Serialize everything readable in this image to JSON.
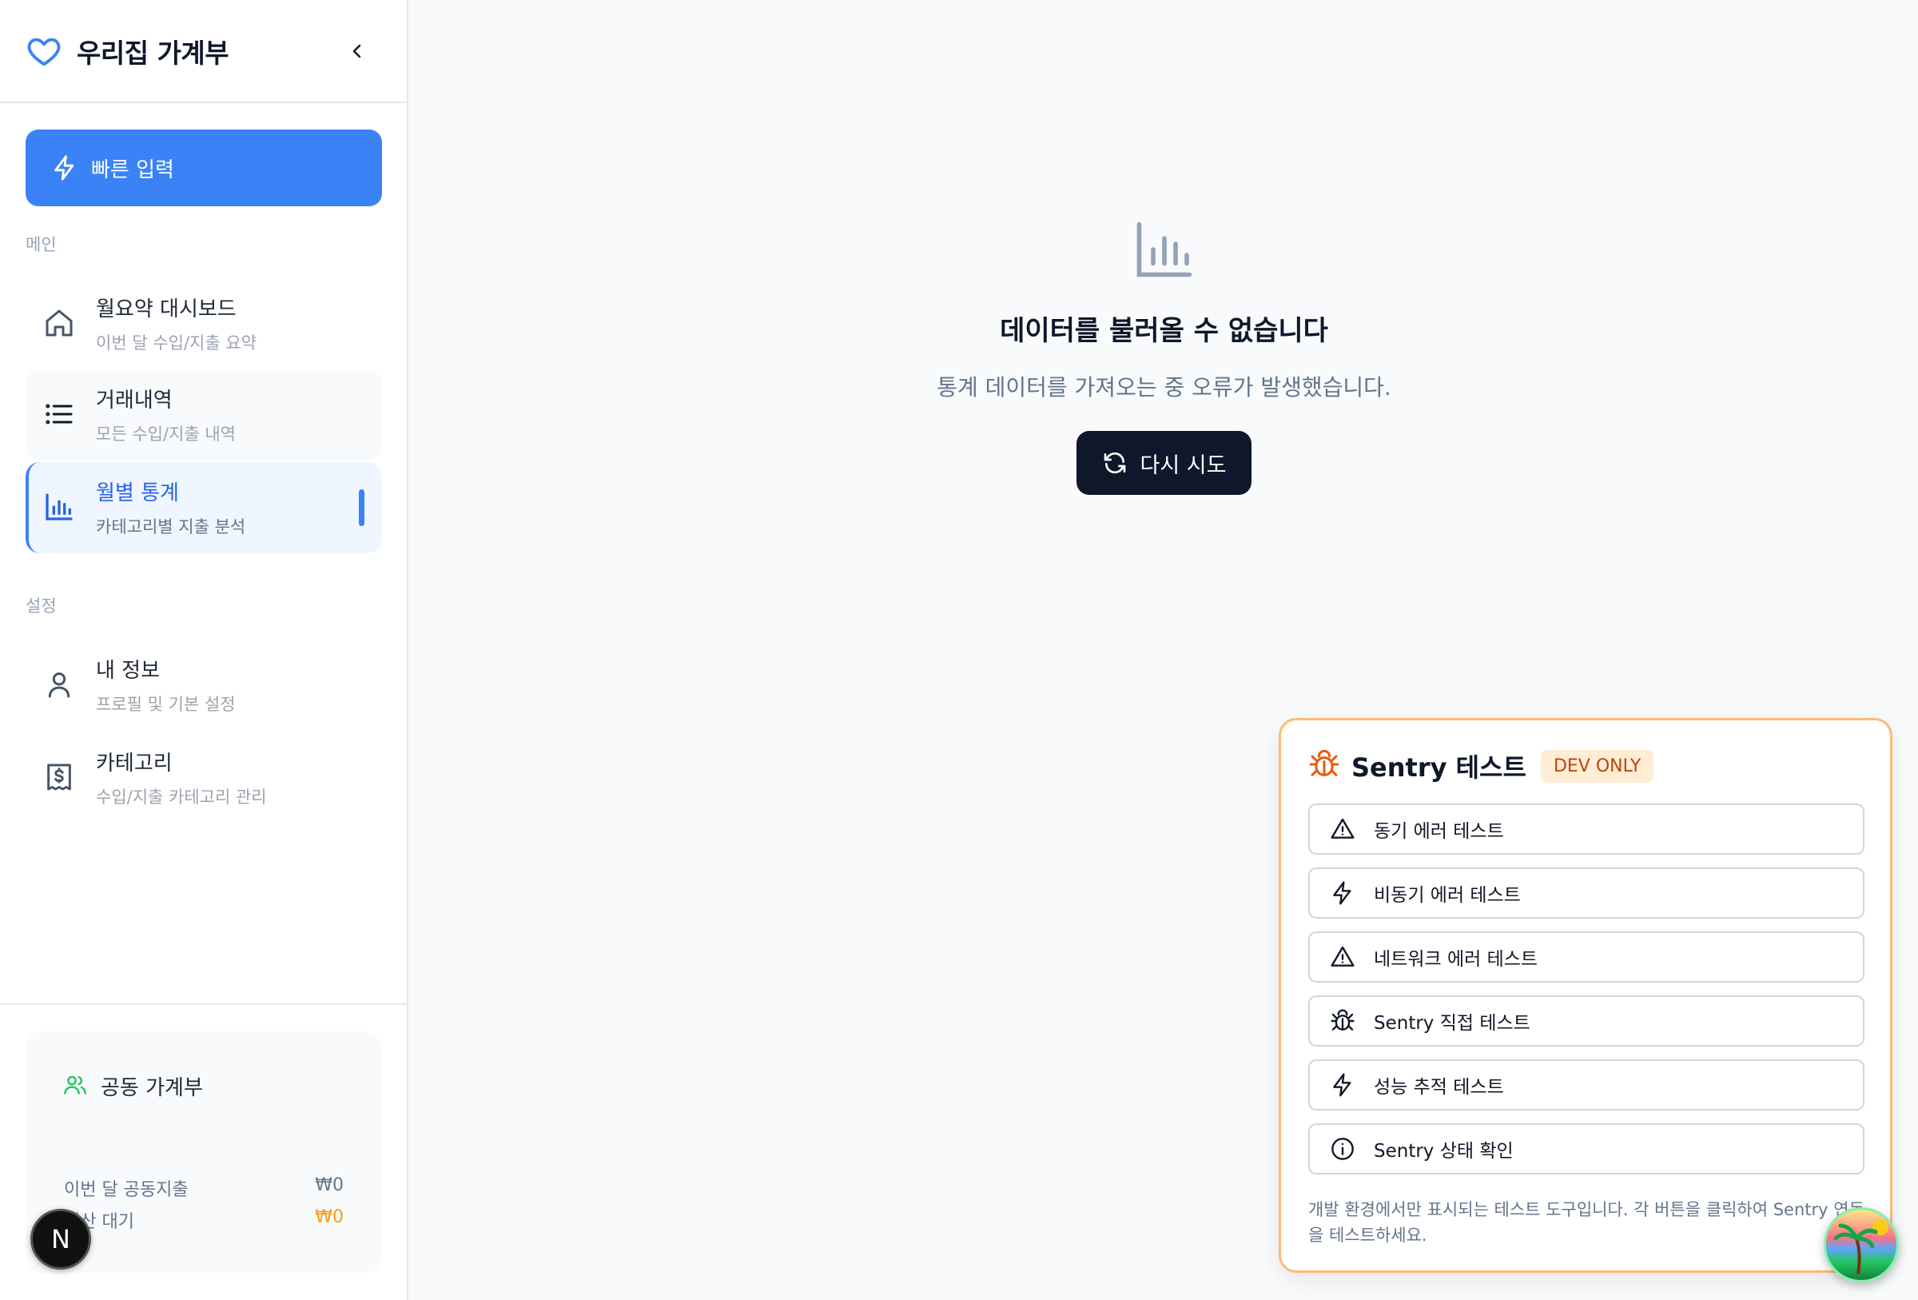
{
  "sidebar": {
    "app_title": "우리집 가계부",
    "quick_input_label": "빠른 입력",
    "sections": {
      "main": "메인",
      "settings": "설정"
    },
    "items": [
      {
        "title": "월요약 대시보드",
        "subtitle": "이번 달 수입/지출 요약",
        "icon": "home-icon"
      },
      {
        "title": "거래내역",
        "subtitle": "모든 수입/지출 내역",
        "icon": "list-icon"
      },
      {
        "title": "월별 통계",
        "subtitle": "카테고리별 지출 분석",
        "icon": "bar-chart-icon",
        "active": true
      },
      {
        "title": "내 정보",
        "subtitle": "프로필 및 기본 설정",
        "icon": "user-icon"
      },
      {
        "title": "카테고리",
        "subtitle": "수입/지출 카테고리 관리",
        "icon": "receipt-icon"
      }
    ],
    "shared_budget": {
      "title": "공동 가계부",
      "rows": [
        {
          "label": "이번 달 공동지출",
          "amount": "₩0"
        },
        {
          "label": "정산 대기",
          "amount": "₩0"
        }
      ]
    }
  },
  "main": {
    "error_title": "데이터를 불러올 수 없습니다",
    "error_description": "통계 데이터를 가져오는 중 오류가 발생했습니다.",
    "retry_label": "다시 시도"
  },
  "sentry_panel": {
    "title": "Sentry 테스트",
    "badge": "DEV ONLY",
    "buttons": [
      {
        "label": "동기 에러 테스트",
        "icon": "warning-icon"
      },
      {
        "label": "비동기 에러 테스트",
        "icon": "lightning-icon"
      },
      {
        "label": "네트워크 에러 테스트",
        "icon": "warning-icon"
      },
      {
        "label": "Sentry 직접 테스트",
        "icon": "bug-icon"
      },
      {
        "label": "성능 추적 테스트",
        "icon": "lightning-icon"
      },
      {
        "label": "Sentry 상태 확인",
        "icon": "info-icon"
      }
    ],
    "note": "개발 환경에서만 표시되는 테스트 도구입니다. 각 버튼을 클릭하여 Sentry 연동을 테스트하세요."
  },
  "dev_badge_letter": "N",
  "colors": {
    "accent": "#3b82f6",
    "dark": "#0f172a",
    "sentry_border": "#fdba74",
    "warning_amount": "#f59e0b",
    "shared_icon": "#22c55e"
  }
}
